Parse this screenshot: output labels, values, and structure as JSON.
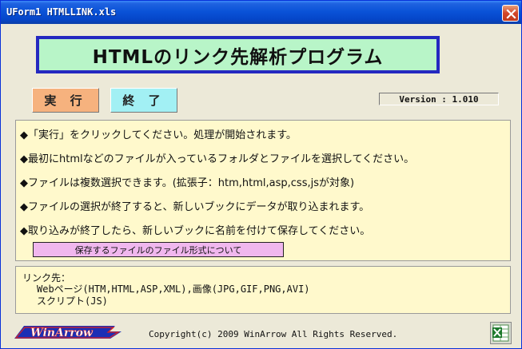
{
  "window": {
    "title": "UForm1 HTMLLINK.xls"
  },
  "banner": {
    "title": "HTMLのリンク先解析プログラム"
  },
  "buttons": {
    "run": "実 行",
    "quit": "終 了",
    "format": "保存するファイルのファイル形式について"
  },
  "version": "Version : 1.010",
  "info": {
    "lines": [
      "◆「実行」をクリックしてください。処理が開始されます。",
      "◆最初にhtmlなどのファイルが入っているフォルダとファイルを選択してください。",
      "◆ファイルは複数選択できます。(拡張子：htm,html,asp,css,jsが対象)",
      "◆ファイルの選択が終了すると、新しいブックにデータが取り込まれます。",
      "◆取り込みが終了したら、新しいブックに名前を付けて保存してください。"
    ]
  },
  "links": {
    "heading": "リンク先：",
    "line1": "Webページ(HTM,HTML,ASP,XML),画像(JPG,GIF,PNG,AVI)",
    "line2": "スクリプト(JS)"
  },
  "footer": {
    "logo_text": "WinArrow",
    "copyright": "Copyright(c) 2009 WinArrow All Rights Reserved."
  },
  "icons": {
    "close": "close-icon",
    "excel": "excel-icon"
  },
  "colors": {
    "titlebar": "#0a53d8",
    "banner_border": "#2428c0",
    "banner_bg": "#b8f5c8",
    "panel_bg": "#fff9cc",
    "run_btn": "#f6b27e",
    "quit_btn": "#a2f0f4",
    "format_btn": "#f0b7ee"
  }
}
